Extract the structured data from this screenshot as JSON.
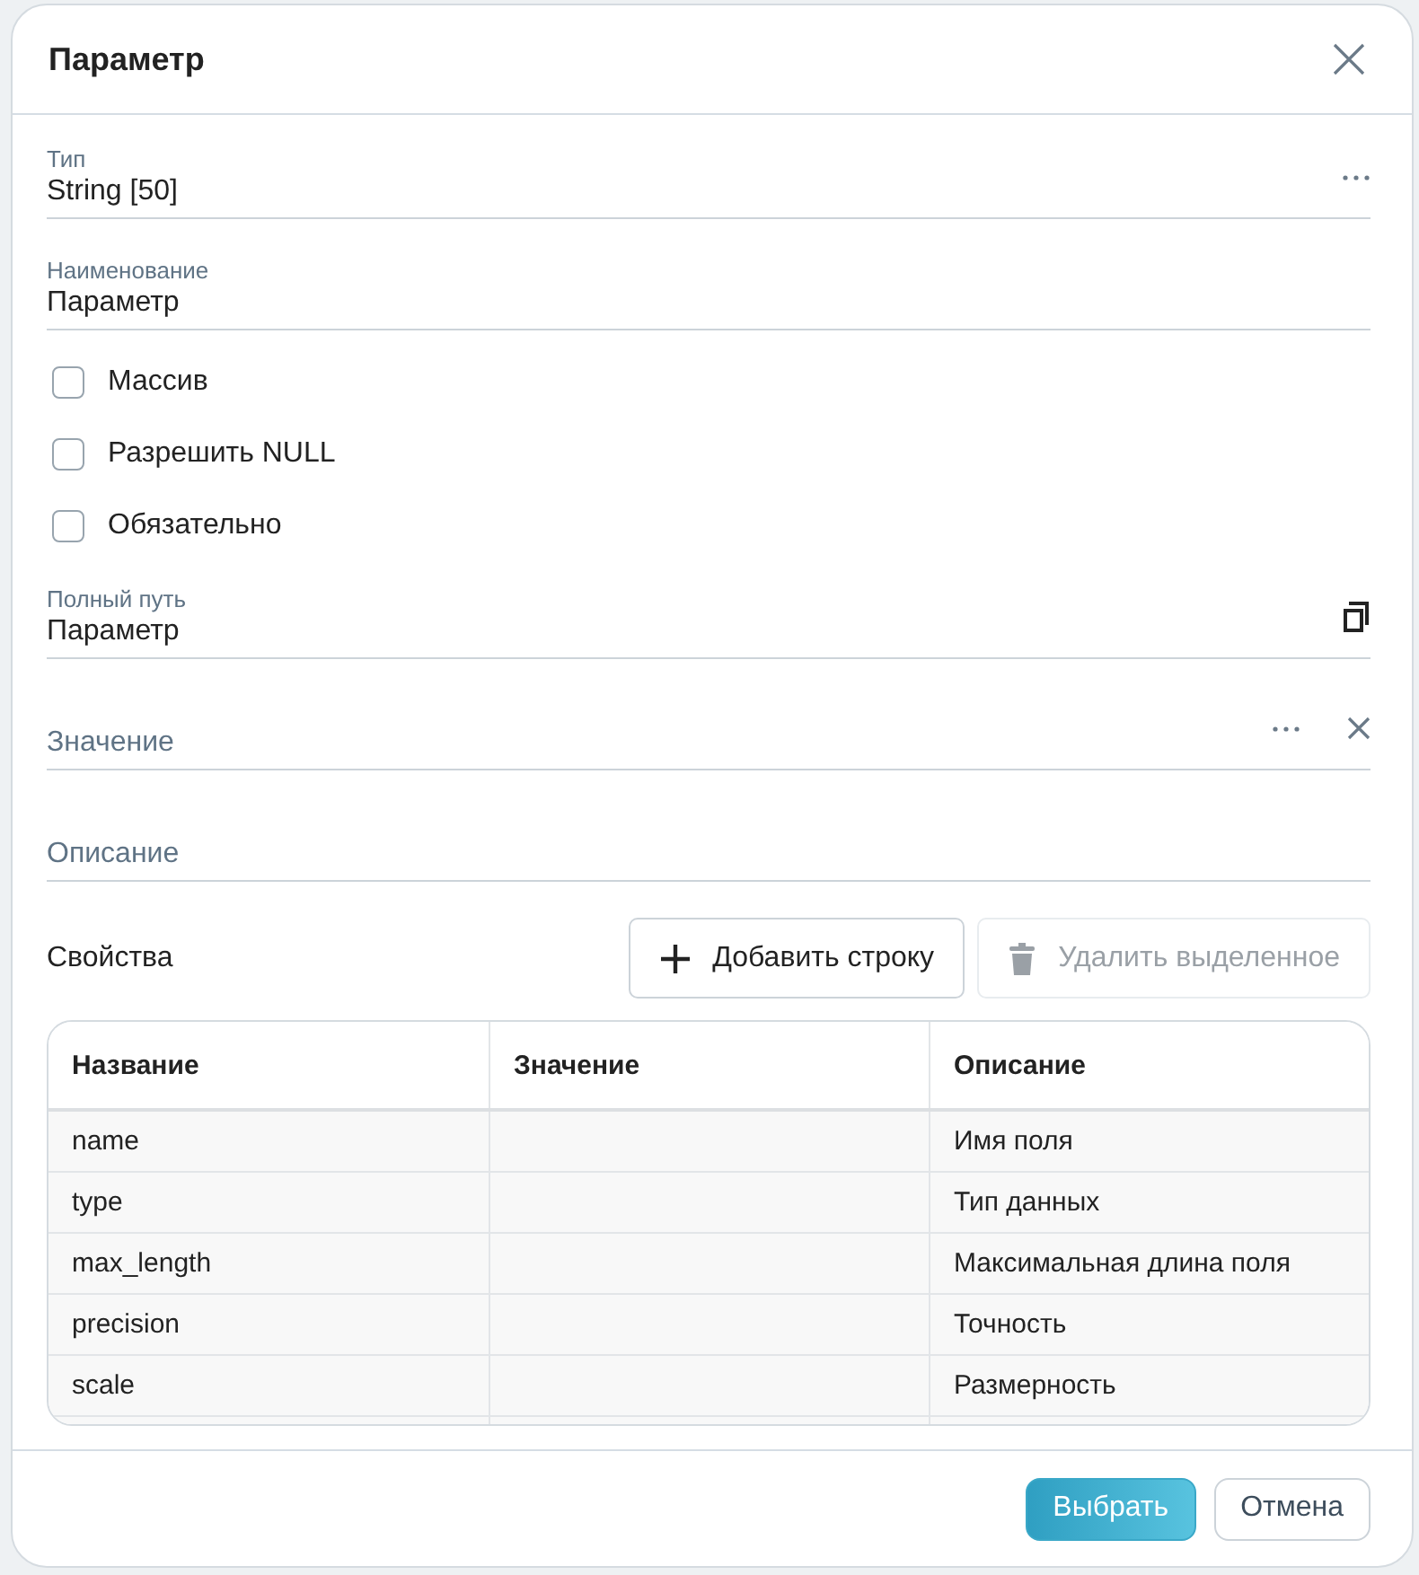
{
  "dialog": {
    "title": "Параметр"
  },
  "fields": [
    {
      "kind": "text",
      "label": "Тип",
      "value": "String [50]",
      "more": true
    },
    {
      "kind": "text",
      "label": "Наименование",
      "value": "Параметр"
    }
  ],
  "checkboxes": [
    {
      "label": "Массив",
      "checked": false
    },
    {
      "label": "Разрешить NULL",
      "checked": false
    },
    {
      "label": "Обязательно",
      "checked": false
    }
  ],
  "fields2": [
    {
      "kind": "text",
      "label": "Полный путь",
      "value": "Параметр",
      "copy": true
    },
    {
      "kind": "empty",
      "placeholder": "Значение",
      "more": true,
      "clear": true
    },
    {
      "kind": "empty",
      "placeholder": "Описание"
    }
  ],
  "properties": {
    "title": "Свойства",
    "buttons": [
      {
        "kind": "add",
        "label": "Добавить строку",
        "disabled": false
      },
      {
        "kind": "delete",
        "label": "Удалить выделенное",
        "disabled": true
      }
    ],
    "columns": [
      "Название",
      "Значение",
      "Описание"
    ],
    "rows": [
      [
        "name",
        "",
        "Имя поля"
      ],
      [
        "type",
        "",
        "Тип данных"
      ],
      [
        "max_length",
        "",
        "Максимальная длина поля"
      ],
      [
        "precision",
        "",
        "Точность"
      ],
      [
        "scale",
        "",
        "Размерность"
      ]
    ]
  },
  "footer": {
    "buttons": [
      {
        "kind": "primary",
        "label": "Выбрать"
      },
      {
        "kind": "secondary",
        "label": "Отмена"
      }
    ]
  }
}
